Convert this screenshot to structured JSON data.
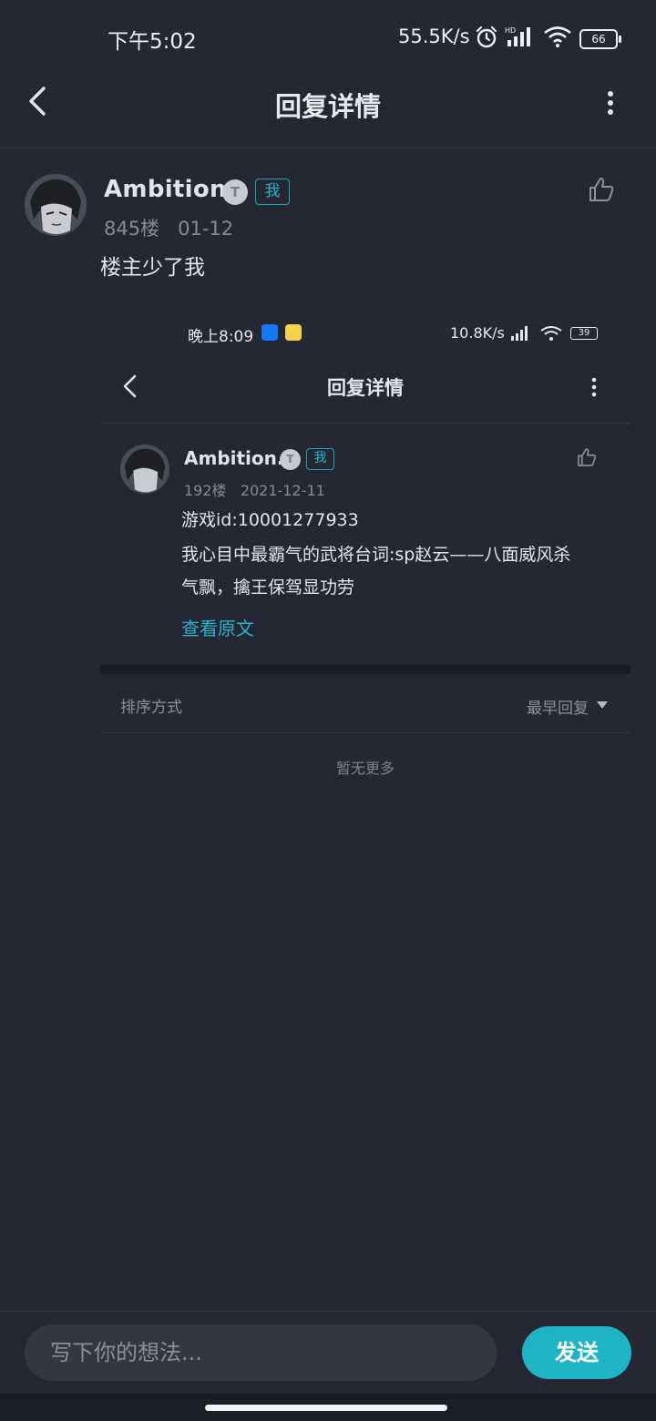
{
  "status_bar": {
    "time": "下午5:02",
    "network_speed": "55.5K/s",
    "battery": "66",
    "icons": [
      "alarm-icon",
      "hd-signal-icon",
      "wifi-icon",
      "battery-icon"
    ]
  },
  "header": {
    "title": "回复详情",
    "back_icon": "chevron-left-icon",
    "more_icon": "more-vertical-icon"
  },
  "reply": {
    "username": "Ambition.",
    "level_badge": "T",
    "me_tag": "我",
    "floor": "845楼",
    "date": "01-12",
    "content": "楼主少了我"
  },
  "embedded_screenshot": {
    "status_time": "晚上8:09",
    "status_speed": "10.8K/s",
    "status_battery": "39",
    "title": "回复详情",
    "username": "Ambition.",
    "level_badge": "T",
    "me_tag": "我",
    "floor": "192楼",
    "date": "2021-12-11",
    "lines": [
      "游戏id:10001277933",
      "我心目中最霸气的武将台词:sp赵云——八面威风杀",
      "气飘，擒王保驾显功劳"
    ],
    "view_original": "查看原文",
    "sort_label": "排序方式",
    "sort_value": "最早回复",
    "no_more": "暂无更多"
  },
  "composer": {
    "placeholder": "写下你的想法...",
    "send_label": "发送"
  },
  "colors": {
    "background": "#252833",
    "accent": "#1fb4c5"
  }
}
